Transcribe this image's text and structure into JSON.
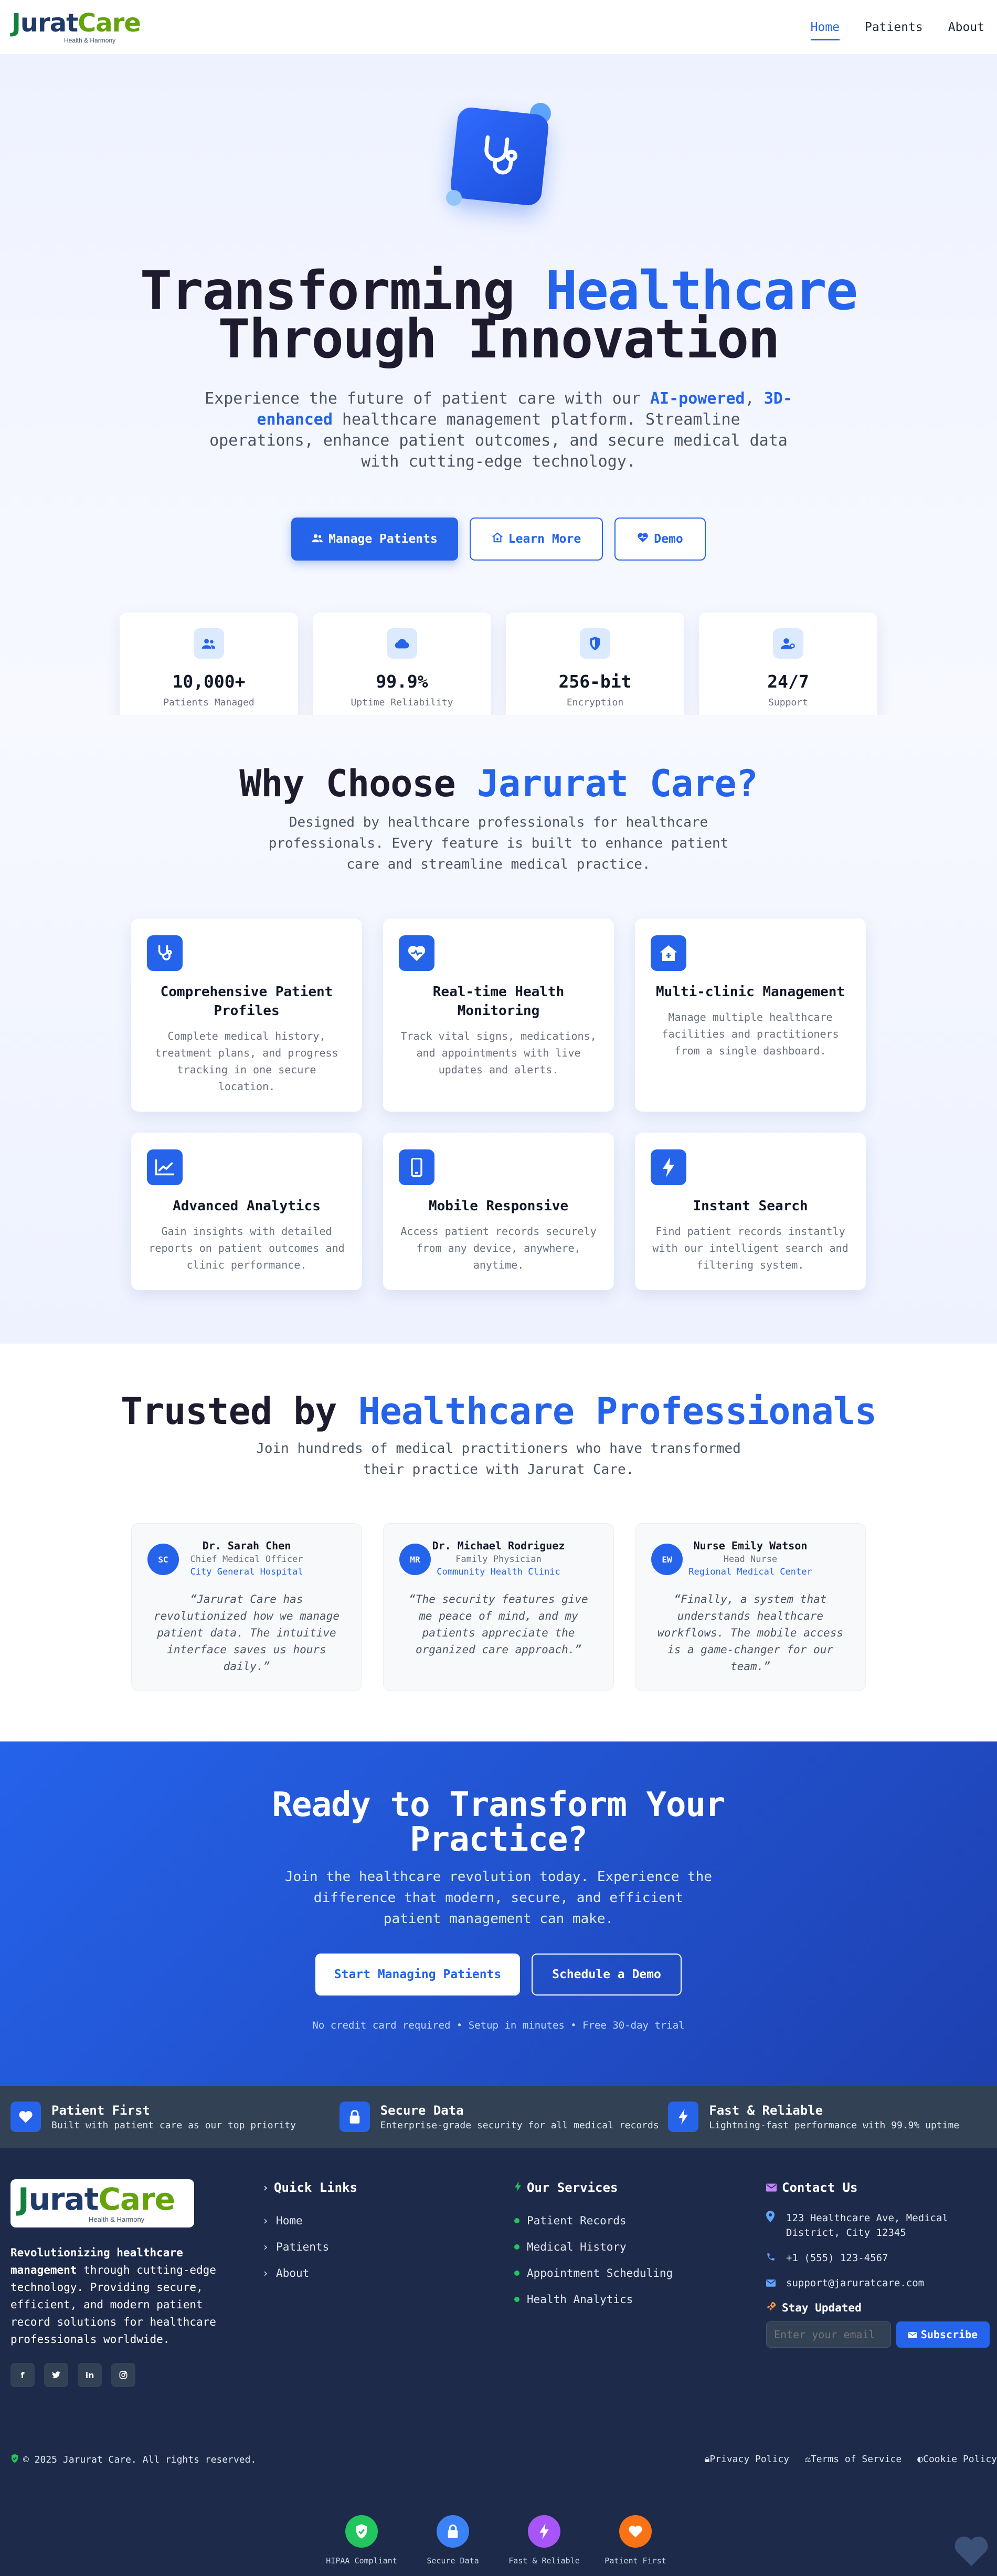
{
  "brand": {
    "logo_j": "J",
    "logo_urat": "urat",
    "logo_care": "Care",
    "tagline": "Health & Harmony"
  },
  "nav": {
    "items": [
      {
        "label": "Home",
        "active": true
      },
      {
        "label": "Patients"
      },
      {
        "label": "About"
      }
    ]
  },
  "hero": {
    "title_part1": "Transforming ",
    "title_accent": "Healthcare",
    "title_line2": "Through Innovation",
    "desc_part1": "Experience the future of patient care with our ",
    "desc_bold1": "AI-powered",
    "desc_sep": ", ",
    "desc_bold2": "3D-enhanced",
    "desc_part2": " healthcare management platform. Streamline operations, enhance patient outcomes, and secure medical data with cutting-edge technology.",
    "buttons": {
      "manage": "Manage Patients",
      "learn": "Learn More",
      "demo": "Demo"
    },
    "stats": [
      {
        "value": "10,000+",
        "label": "Patients Managed",
        "icon": "users-icon"
      },
      {
        "value": "99.9%",
        "label": "Uptime Reliability",
        "icon": "cloud-icon"
      },
      {
        "value": "256-bit",
        "label": "Encryption",
        "icon": "shield-icon"
      },
      {
        "value": "24/7",
        "label": "Support",
        "icon": "user-support-icon"
      }
    ]
  },
  "features": {
    "title_part1": "Why Choose ",
    "title_accent": "Jarurat Care?",
    "desc": "Designed by healthcare professionals for healthcare professionals. Every feature is built to enhance patient care and streamline medical practice.",
    "cards": [
      {
        "title": "Comprehensive Patient Profiles",
        "desc": "Complete medical history, treatment plans, and progress tracking in one secure location.",
        "icon": "stethoscope-icon"
      },
      {
        "title": "Real-time Health Monitoring",
        "desc": "Track vital signs, medications, and appointments with live updates and alerts.",
        "icon": "heart-pulse-icon"
      },
      {
        "title": "Multi-clinic Management",
        "desc": "Manage multiple healthcare facilities and practitioners from a single dashboard.",
        "icon": "clinic-icon"
      },
      {
        "title": "Advanced Analytics",
        "desc": "Gain insights with detailed reports on patient outcomes and clinic performance.",
        "icon": "chart-line-icon"
      },
      {
        "title": "Mobile Responsive",
        "desc": "Access patient records securely from any device, anywhere, anytime.",
        "icon": "mobile-icon"
      },
      {
        "title": "Instant Search",
        "desc": "Find patient records instantly with our intelligent search and filtering system.",
        "icon": "bolt-icon"
      }
    ]
  },
  "testimonials": {
    "title_part1": "Trusted by ",
    "title_accent": "Healthcare Professionals",
    "desc": "Join hundreds of medical practitioners who have transformed their practice with Jarurat Care.",
    "items": [
      {
        "initials": "SC",
        "name": "Dr. Sarah Chen",
        "role": "Chief Medical Officer",
        "org": "City General Hospital",
        "quote": "“Jarurat Care has revolutionized how we manage patient data. The intuitive interface saves us hours daily.”"
      },
      {
        "initials": "MR",
        "name": "Dr. Michael Rodriguez",
        "role": "Family Physician",
        "org": "Community Health Clinic",
        "quote": "“The security features give me peace of mind, and my patients appreciate the organized care approach.”"
      },
      {
        "initials": "EW",
        "name": "Nurse Emily Watson",
        "role": "Head Nurse",
        "org": "Regional Medical Center",
        "quote": "“Finally, a system that understands healthcare workflows. The mobile access is a game-changer for our team.”"
      }
    ]
  },
  "cta": {
    "title_line1": "Ready to Transform Your",
    "title_line2": "Practice?",
    "desc": "Join the healthcare revolution today. Experience the difference that modern, secure, and efficient patient management can make.",
    "primary": "Start Managing Patients",
    "secondary": "Schedule a Demo",
    "note": "No credit card required • Setup in minutes • Free 30-day trial"
  },
  "footer": {
    "trust": [
      {
        "title": "Patient First",
        "desc": "Built with patient care as our top priority",
        "icon": "heart-icon"
      },
      {
        "title": "Secure Data",
        "desc": "Enterprise-grade security for all medical records",
        "icon": "lock-icon"
      },
      {
        "title": "Fast & Reliable",
        "desc": "Lightning-fast performance with 99.9% uptime",
        "icon": "bolt-icon"
      }
    ],
    "about_bold": "Revolutionizing healthcare management",
    "about_rest": " through cutting-edge technology. Providing secure, efficient, and modern patient record solutions for healthcare professionals worldwide.",
    "socials": [
      "f",
      "t",
      "in",
      "ig"
    ],
    "quick_links_title": "Quick Links",
    "quick_links": [
      "Home",
      "Patients",
      "About"
    ],
    "services_title": "Our Services",
    "services": [
      "Patient Records",
      "Medical History",
      "Appointment Scheduling",
      "Health Analytics"
    ],
    "contact_title": "Contact Us",
    "contact": {
      "address": "123 Healthcare Ave, Medical District, City 12345",
      "phone": "+1 (555) 123-4567",
      "email": "support@jaruratcare.com"
    },
    "stay_updated": "Stay Updated",
    "email_placeholder": "Enter your email",
    "subscribe": "Subscribe",
    "copyright": "© 2025 Jarurat Care. All rights reserved.",
    "legal": [
      "Privacy Policy",
      "Terms of Service",
      "Cookie Policy"
    ],
    "badges": [
      {
        "label": "HIPAA Compliant",
        "color": "#22c55e",
        "icon": "shield-check-icon"
      },
      {
        "label": "Secure Data",
        "color": "#3b82f6",
        "icon": "lock-icon"
      },
      {
        "label": "Fast & Reliable",
        "color": "#a855f7",
        "icon": "bolt-icon"
      },
      {
        "label": "Patient First",
        "color": "#f97316",
        "icon": "heart-icon"
      }
    ]
  },
  "colors": {
    "primary": "#2563eb",
    "dark": "#1e2a4a",
    "green": "#22c55e"
  }
}
